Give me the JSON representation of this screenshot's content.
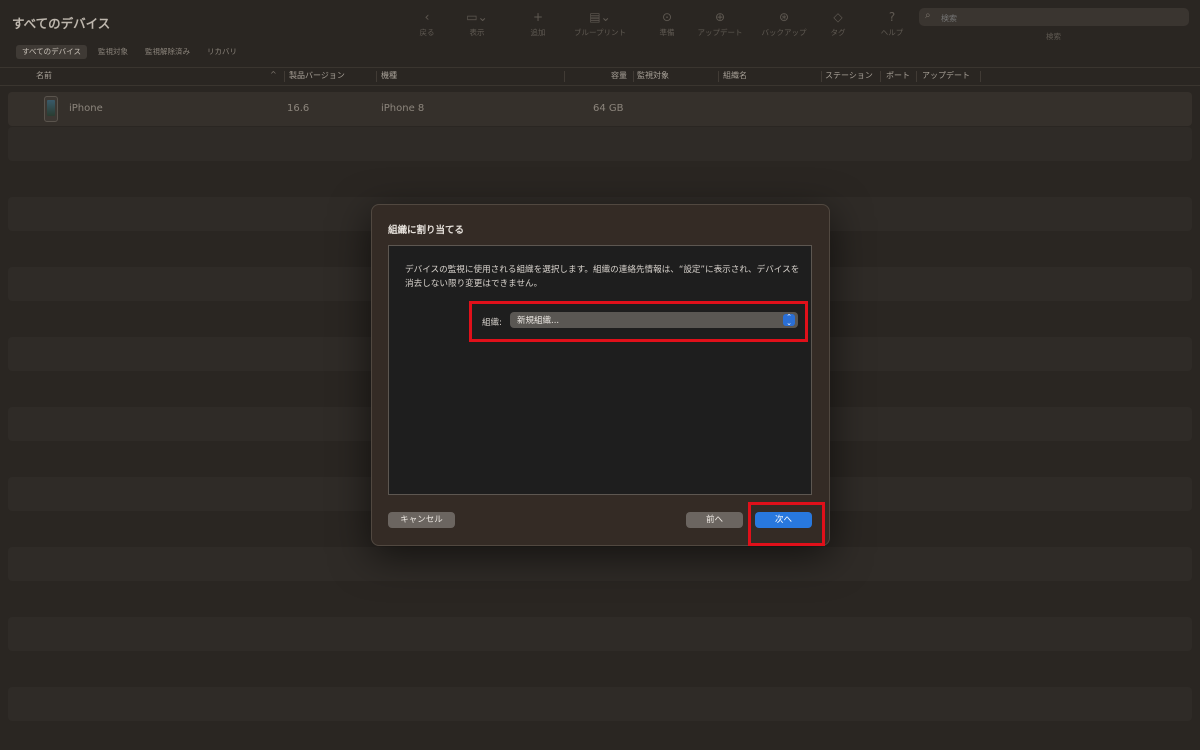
{
  "window": {
    "title": "すべてのデバイス"
  },
  "toolbar": {
    "items": [
      {
        "label": "戻る",
        "icon": "chevron-left-icon",
        "glyph": "‹"
      },
      {
        "label": "表示",
        "icon": "view-icon",
        "glyph": "▭⌄"
      },
      {
        "label": "追加",
        "icon": "plus-icon",
        "glyph": "+"
      },
      {
        "label": "ブループリント",
        "icon": "blueprint-icon",
        "glyph": "▤⌄"
      },
      {
        "label": "準備",
        "icon": "prepare-icon",
        "glyph": "⊙"
      },
      {
        "label": "アップデート",
        "icon": "update-icon",
        "glyph": "⊕"
      },
      {
        "label": "バックアップ",
        "icon": "backup-icon",
        "glyph": "⊛"
      },
      {
        "label": "タグ",
        "icon": "tag-icon",
        "glyph": "◇"
      },
      {
        "label": "ヘルプ",
        "icon": "help-icon",
        "glyph": "?"
      }
    ],
    "search_placeholder": "検索",
    "search_label": "検索"
  },
  "scope_tabs": [
    "すべてのデバイス",
    "監視対象",
    "監視解除済み",
    "リカバリ"
  ],
  "table": {
    "columns": [
      "名前",
      "製品バージョン",
      "機種",
      "容量",
      "監視対象",
      "組織名",
      "ステーション",
      "ポート",
      "アップデート"
    ],
    "rows": [
      {
        "name": "iPhone",
        "version": "16.6",
        "model": "iPhone 8",
        "capacity": "64 GB"
      }
    ]
  },
  "dialog": {
    "title": "組織に割り当てる",
    "description": "デバイスの監視に使用される組織を選択します。組織の連絡先情報は、“設定”に表示され、デバイスを消去しない限り変更はできません。",
    "org_label": "組織:",
    "org_value": "新規組織...",
    "cancel_label": "キャンセル",
    "prev_label": "前へ",
    "next_label": "次へ"
  },
  "colors": {
    "accent": "#2878de",
    "highlight": "#e0101a",
    "background": "#2a2622"
  }
}
